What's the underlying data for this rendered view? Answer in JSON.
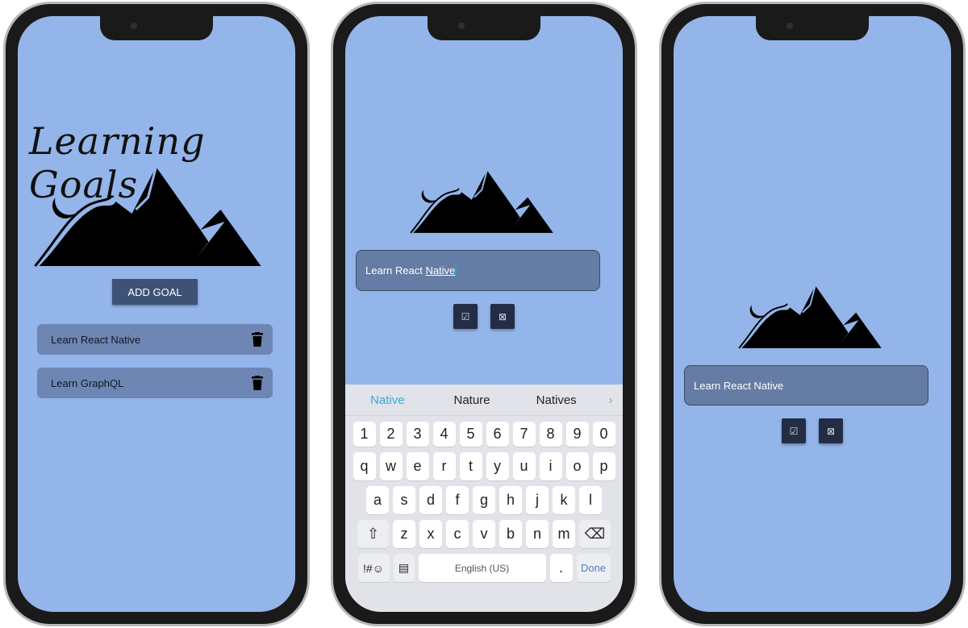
{
  "phone1": {
    "title": "Learning Goals",
    "add_goal_label": "ADD GOAL",
    "goals": [
      {
        "text": "Learn React Native",
        "icon": "trash-icon"
      },
      {
        "text": "Learn GraphQL",
        "icon": "trash-icon"
      }
    ]
  },
  "phone2": {
    "input_prefix": "Learn React ",
    "input_word": "Native",
    "confirm_icon": "☑",
    "cancel_icon": "⊠",
    "keyboard": {
      "suggestions": [
        "Native",
        "Nature",
        "Natives"
      ],
      "numbers": [
        "1",
        "2",
        "3",
        "4",
        "5",
        "6",
        "7",
        "8",
        "9",
        "0"
      ],
      "row1": [
        "q",
        "w",
        "e",
        "r",
        "t",
        "y",
        "u",
        "i",
        "o",
        "p"
      ],
      "row2": [
        "a",
        "s",
        "d",
        "f",
        "g",
        "h",
        "j",
        "k",
        "l"
      ],
      "row3": [
        "z",
        "x",
        "c",
        "v",
        "b",
        "n",
        "m"
      ],
      "symbols": "!#☺",
      "space": "English (US)",
      "period": ".",
      "done": "Done"
    }
  },
  "phone3": {
    "input_value": "Learn React Native",
    "confirm_icon": "☑",
    "cancel_icon": "⊠"
  },
  "colors": {
    "background": "#94b5ea",
    "button": "#3d5274",
    "item": "#6e86b3",
    "input": "#657ca4",
    "suggestion_active": "#3aa8d8"
  }
}
